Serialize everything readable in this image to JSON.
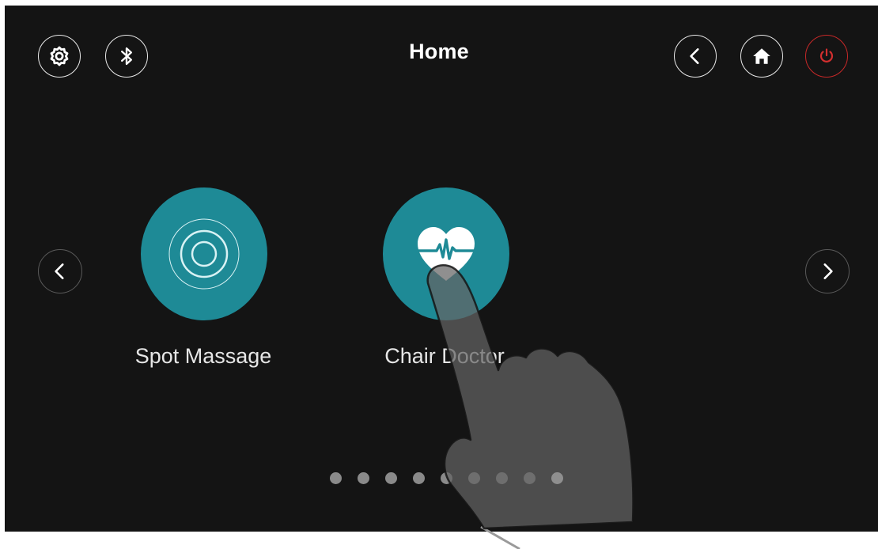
{
  "header": {
    "title": "Home"
  },
  "icons": {
    "settings": "gear-icon",
    "bluetooth": "bluetooth-icon",
    "back": "chevron-left-icon",
    "home": "home-icon",
    "power": "power-icon"
  },
  "menu": {
    "items": [
      {
        "label": "Spot Massage",
        "icon": "concentric-rings-icon"
      },
      {
        "label": "Chair Doctor",
        "icon": "heart-pulse-icon"
      }
    ]
  },
  "pagination": {
    "total": 9,
    "current": 9
  },
  "colors": {
    "background": "#141414",
    "tile": "#1e8a96",
    "power": "#c62828",
    "text": "#ffffff"
  }
}
